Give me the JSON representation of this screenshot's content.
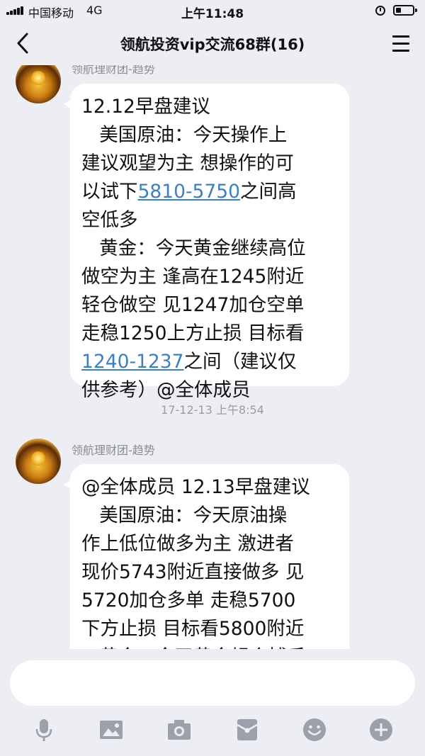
{
  "status_bar": {
    "carrier": "中国移动",
    "network": "4G",
    "time": "上午11:48"
  },
  "header": {
    "title": "领航投资vip交流68群(16)"
  },
  "messages": [
    {
      "sender": "领航理财团-趋势",
      "lines": [
        [
          {
            "text": "12.12早盘建议"
          }
        ],
        [
          {
            "text": "   美国原油：今天操作上"
          }
        ],
        [
          {
            "text": "建议观望为主 想操作的可"
          }
        ],
        [
          {
            "text": "以试下"
          },
          {
            "text": "5810-5750",
            "link": true
          },
          {
            "text": "之间高"
          }
        ],
        [
          {
            "text": "空低多"
          }
        ],
        [
          {
            "text": "   黄金：今天黄金继续高位"
          }
        ],
        [
          {
            "text": "做空为主 逢高在1245附近"
          }
        ],
        [
          {
            "text": "轻仓做空 见1247加仓空单"
          }
        ],
        [
          {
            "text": "走稳1250上方止损 目标看"
          }
        ],
        [
          {
            "text": "1240-1237",
            "link": true
          },
          {
            "text": "之间（建议仅"
          }
        ],
        [
          {
            "text": "供参考）@全体成员"
          }
        ]
      ]
    },
    {
      "timestamp": "17-12-13 上午8:54"
    },
    {
      "sender": "领航理财团-趋势",
      "lines": [
        [
          {
            "text": "@全体成员 12.13早盘建议"
          }
        ],
        [
          {
            "text": "   美国原油：今天原油操"
          }
        ],
        [
          {
            "text": "作上低位做多为主 激进者"
          }
        ],
        [
          {
            "text": "现价5743附近直接做多 见"
          }
        ],
        [
          {
            "text": "5720加仓多单 走稳5700"
          }
        ],
        [
          {
            "text": "下方止损 目标看5800附近"
          }
        ],
        [
          {
            "text": "   黄金：今天黄金轻仓博反"
          }
        ]
      ]
    }
  ],
  "composer": {
    "placeholder": "",
    "tools": [
      "microphone-icon",
      "image-icon",
      "camera-icon",
      "red-packet-icon",
      "emoji-icon",
      "plus-icon"
    ]
  }
}
